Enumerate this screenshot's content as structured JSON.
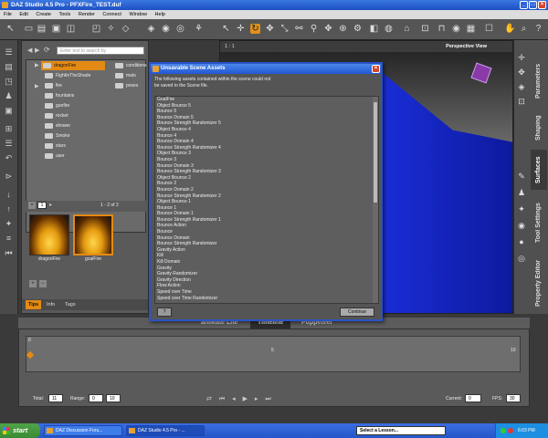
{
  "window": {
    "title": "DAZ Studio 4.5 Pro - PFXFire_TEST.duf"
  },
  "menu": [
    "File",
    "Edit",
    "Create",
    "Tools",
    "Render",
    "Connect",
    "Window",
    "Help"
  ],
  "library": {
    "search_placeholder": "Enter text to search by",
    "tree": [
      "dragonFire",
      "FightInTheShade",
      "fire",
      "fountains",
      "gunfire",
      "rocket",
      "shower",
      "Smoke",
      "stars",
      "user"
    ],
    "right_col": [
      "conditions",
      "mats",
      "poses"
    ],
    "page_field": "1",
    "page_info": "1 - 2 of 2",
    "thumbs": [
      "dragonFire",
      "goalFire"
    ],
    "tabs": [
      "Tips",
      "Info",
      "Tags"
    ]
  },
  "viewport": {
    "label": "1 : 1",
    "camera": "Perspective View"
  },
  "right_tabs": [
    "Parameters",
    "Shaping",
    "Surfaces",
    "Tool Settings",
    "Property Editor"
  ],
  "timeline": {
    "tabs": [
      "aniMate Lite",
      "Timeline",
      "Puppeteer"
    ],
    "total_label": "Total:",
    "total": "11",
    "range_label": "Range:",
    "range_start": "0",
    "range_end": "10",
    "current_label": "Current:",
    "current": "0",
    "fps_label": "FPS:",
    "fps": "30",
    "marks": [
      "0",
      "5",
      "10"
    ]
  },
  "dialog": {
    "title": "Unsavable Scene Assets",
    "message_line1": "The following assets contained within the scene could not",
    "message_line2": "be saved to the Scene file.",
    "items": [
      "GoalFire",
      "Object Bounce 5",
      "Bounce 5",
      "Bounce Domain 5",
      "Bounce Strength Randomizer 5",
      "Object Bounce 4",
      "Bounce 4",
      "Bounce Domain 4",
      "Bounce Strength Randomizer 4",
      "Object Bounce 3",
      "Bounce 3",
      "Bounce Domain 3",
      "Bounce Strength Randomizer 3",
      "Object Bounce 2",
      "Bounce 2",
      "Bounce Domain 2",
      "Bounce Strength Randomizer 2",
      "Object Bounce 1",
      "Bounce 1",
      "Bounce Domain 1",
      "Bounce Strength Randomizer 1",
      "Bounce Action",
      "Bounce",
      "Bounce Domain",
      "Bounce Strength Randomizer",
      "Gravity Action",
      "Kill",
      "Kill Domain",
      "Gravity",
      "Gravity Randomizer",
      "Gravity Direction",
      "Flow Action",
      "Speed over Time",
      "Speed over Time Randomizer"
    ],
    "help_label": "?",
    "continue_label": "Continue"
  },
  "taskbar": {
    "start_label": "start",
    "tasks": [
      "DAZ Discussion Foru...",
      "DAZ Studio 4.5 Pro - ..."
    ],
    "lesson_placeholder": "Select a Lesson...",
    "clock": "6:03 PM"
  }
}
